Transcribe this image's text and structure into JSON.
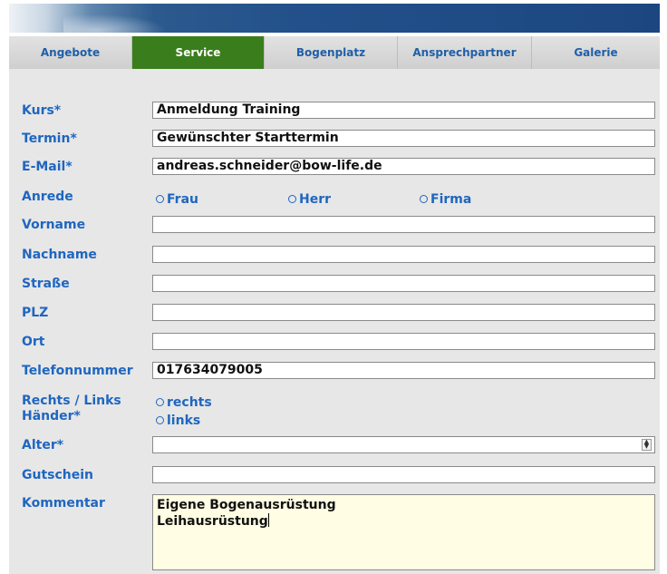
{
  "nav": {
    "tabs": [
      {
        "label": "Angebote"
      },
      {
        "label": "Service"
      },
      {
        "label": "Bogenplatz"
      },
      {
        "label": "Ansprechpartner"
      },
      {
        "label": "Galerie"
      }
    ],
    "active_tab": "Service"
  },
  "form": {
    "kurs": {
      "label": "Kurs*",
      "value": "Anmeldung Training"
    },
    "termin": {
      "label": "Termin*",
      "value": "Gewünschter Starttermin"
    },
    "email": {
      "label": "E-Mail*",
      "value": "andreas.schneider@bow-life.de"
    },
    "anrede": {
      "label": "Anrede",
      "options": [
        {
          "label": "Frau"
        },
        {
          "label": "Herr"
        },
        {
          "label": "Firma"
        }
      ],
      "selected": ""
    },
    "vorname": {
      "label": "Vorname",
      "value": ""
    },
    "nachname": {
      "label": "Nachname",
      "value": ""
    },
    "strasse": {
      "label": "Straße",
      "value": ""
    },
    "plz": {
      "label": "PLZ",
      "value": ""
    },
    "ort": {
      "label": "Ort",
      "value": ""
    },
    "telefon": {
      "label": "Telefonnummer",
      "value": "017634079005"
    },
    "haender": {
      "label_line1": "Rechts / Links",
      "label_line2": "Händer*",
      "options": [
        {
          "label": "rechts"
        },
        {
          "label": "links"
        }
      ],
      "selected": ""
    },
    "alter": {
      "label": "Alter*",
      "value": ""
    },
    "gutschein": {
      "label": "Gutschein",
      "value": ""
    },
    "kommentar": {
      "label": "Kommentar",
      "line1": "Eigene Bogenausrüstung",
      "line2": "Leihausrüstung"
    }
  },
  "colors": {
    "label_blue": "#1f66c0",
    "active_tab_green": "#3a7d1c",
    "banner_blue": "#1e4a84",
    "comment_bg": "#fffde3"
  }
}
